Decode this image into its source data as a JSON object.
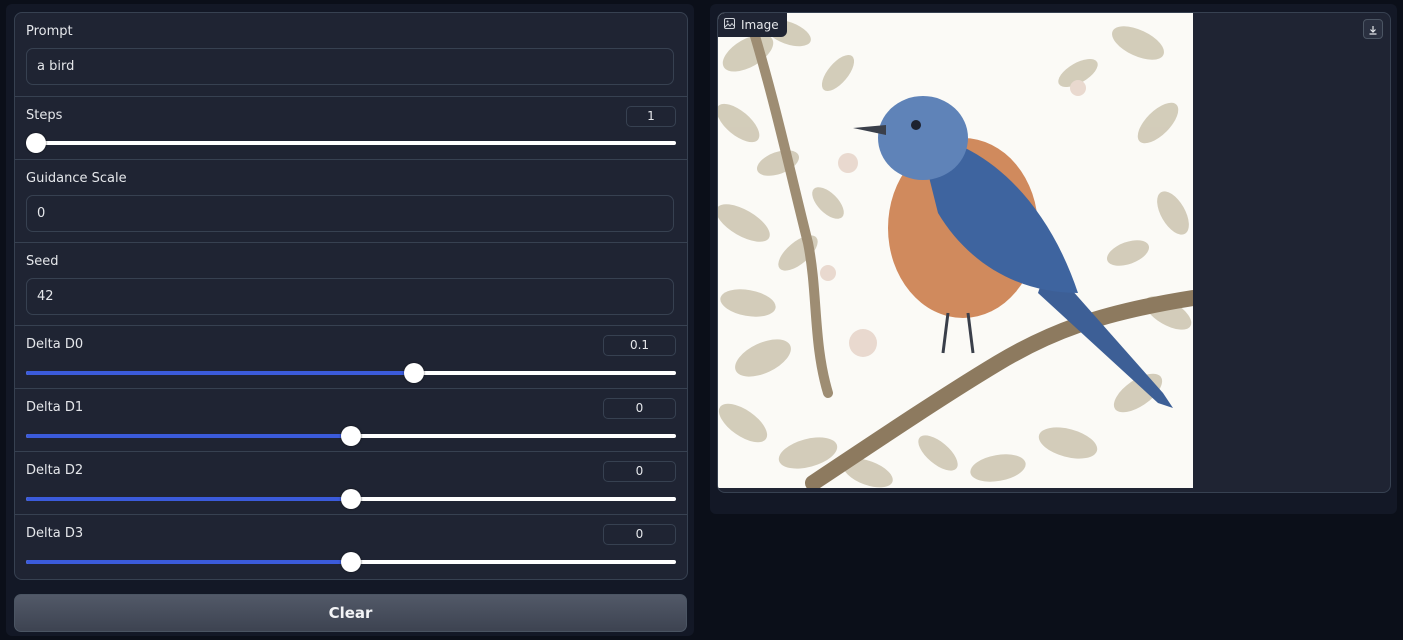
{
  "inputs": {
    "prompt": {
      "label": "Prompt",
      "value": "a bird"
    },
    "steps": {
      "label": "Steps",
      "value": "1",
      "fraction": 0.0
    },
    "guidance": {
      "label": "Guidance Scale",
      "value": "0"
    },
    "seed": {
      "label": "Seed",
      "value": "42"
    },
    "delta_d0": {
      "label": "Delta D0",
      "value": "0.1",
      "fraction": 0.6
    },
    "delta_d1": {
      "label": "Delta D1",
      "value": "0",
      "fraction": 0.5
    },
    "delta_d2": {
      "label": "Delta D2",
      "value": "0",
      "fraction": 0.5
    },
    "delta_d3": {
      "label": "Delta D3",
      "value": "0",
      "fraction": 0.5
    }
  },
  "clear_label": "Clear",
  "output": {
    "label": "Image",
    "icon": "image-icon",
    "download_icon": "download-icon"
  },
  "colors": {
    "accent": "#3b5bdb",
    "panel": "#1f2433",
    "background": "#0b0f19"
  }
}
